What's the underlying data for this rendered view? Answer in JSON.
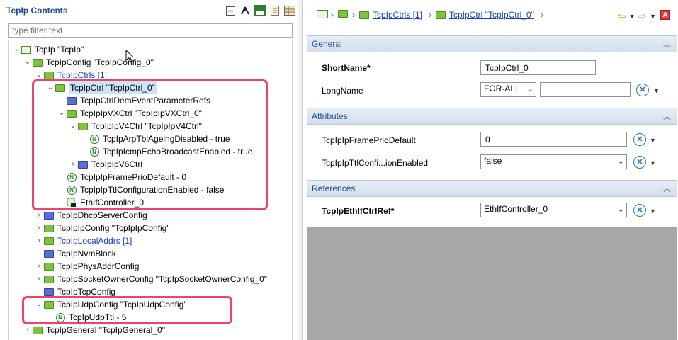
{
  "left_panel": {
    "title": "TcpIp Contents",
    "filter_placeholder": "type filter text",
    "tree": [
      {
        "label": "TcpIp \"TcpIp\""
      },
      {
        "label": "TcpIpConfig \"TcpIpConfig_0\""
      },
      {
        "label": "TcpIpCtrls [1]"
      },
      {
        "label": "TcpIpCtrl \"TcpIpCtrl_0\""
      },
      {
        "label": "TcpIpCtrlDemEventParameterRefs"
      },
      {
        "label": "TcpIpIpVXCtrl \"TcpIpIpVXCtrl_0\""
      },
      {
        "label": "TcpIpIpV4Ctrl \"TcpIpIpV4Ctrl\""
      },
      {
        "label": "TcpIpArpTblAgeingDisabled - true"
      },
      {
        "label": "TcpIpIcmpEchoBroadcastEnabled - true"
      },
      {
        "label": "TcpIpIpV6Ctrl"
      },
      {
        "label": "TcpIpIpFramePrioDefault - 0"
      },
      {
        "label": "TcpIpIpTtlConfigurationEnabled - false"
      },
      {
        "label": "EthIfController_0"
      },
      {
        "label": "TcpIpDhcpServerConfig"
      },
      {
        "label": "TcpIpIpConfig \"TcpIpIpConfig\""
      },
      {
        "label": "TcpIpLocalAddrs [1]"
      },
      {
        "label": "TcpIpNvmBlock"
      },
      {
        "label": "TcpIpPhysAddrConfig"
      },
      {
        "label": "TcpIpSocketOwnerConfig \"TcpIpSocketOwnerConfig_0\""
      },
      {
        "label": "TcpIpTcpConfig"
      },
      {
        "label": "TcpIpUdpConfig \"TcpIpUdpConfig\""
      },
      {
        "label": "TcpIpUdpTtl - 5"
      },
      {
        "label": "TcpIpGeneral \"TcpIpGeneral_0\""
      }
    ]
  },
  "right_panel": {
    "breadcrumb": [
      {
        "label": ""
      },
      {
        "label": ""
      },
      {
        "label": "TcpIpCtrls [1]"
      },
      {
        "label": "TcpIpCtrl \"TcpIpCtrl_0\""
      }
    ],
    "sections": {
      "general": "General",
      "attributes": "Attributes",
      "references": "References"
    },
    "fields": {
      "short_name_label": "ShortName*",
      "short_name_value": "TcpIpCtrl_0",
      "long_name_label": "LongName",
      "long_name_lang": "FOR-ALL",
      "long_name_value": "",
      "frame_prio_label": "TcpIpIpFramePrioDefault",
      "frame_prio_value": "0",
      "ttl_label": "TcpIpIpTtlConfi...ionEnabled",
      "ttl_value": "false",
      "ethif_label": "TcpIpEthIfCtrlRef*",
      "ethif_value": "EthIfController_0"
    },
    "colors": {
      "accent": "#1f4e8c",
      "highlight": "#f0436a"
    }
  }
}
